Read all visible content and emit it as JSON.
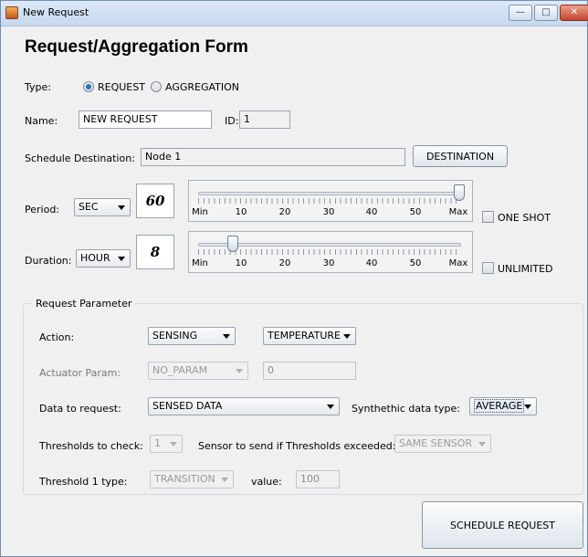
{
  "window": {
    "title": "New Request",
    "controls": {
      "minimize": "—",
      "maximize": "□",
      "close": "✕"
    }
  },
  "form": {
    "title": "Request/Aggregation Form",
    "type": {
      "label": "Type:",
      "options": [
        "REQUEST",
        "AGGREGATION"
      ],
      "selected": "REQUEST"
    },
    "name": {
      "label": "Name:",
      "value": "NEW REQUEST"
    },
    "id": {
      "label": "ID:",
      "value": "1"
    },
    "schedule_destination": {
      "label": "Schedule Destination:",
      "value": "Node 1",
      "button": "DESTINATION"
    },
    "period": {
      "label": "Period:",
      "unit": "SEC",
      "value": "60",
      "slider": {
        "min_label": "Min",
        "max_label": "Max",
        "ticks": [
          "10",
          "20",
          "30",
          "40",
          "50"
        ],
        "level": 1.0
      },
      "checkbox": "ONE SHOT",
      "checked": false
    },
    "duration": {
      "label": "Duration:",
      "unit": "HOUR",
      "value": "8",
      "slider": {
        "min_label": "Min",
        "max_label": "Max",
        "ticks": [
          "10",
          "20",
          "30",
          "40",
          "50"
        ],
        "level": 0.13
      },
      "checkbox": "UNLIMITED",
      "checked": false
    }
  },
  "request_parameter": {
    "title": "Request Parameter",
    "action": {
      "label": "Action:",
      "value": "SENSING",
      "value2": "TEMPERATURE"
    },
    "actuator_param": {
      "label": "Actuator Param:",
      "value": "NO_PARAM",
      "field": "0"
    },
    "data_to_request": {
      "label": "Data to request:",
      "value": "SENSED DATA",
      "synthetic_label": "Synthethic data type:",
      "synthetic_value": "AVERAGE"
    },
    "thresholds": {
      "label": "Thresholds to check:",
      "value": "1",
      "sensor_label": "Sensor to send if Thresholds exceeded:",
      "sensor_value": "SAME SENSOR"
    },
    "threshold1": {
      "label": "Threshold 1 type:",
      "value": "TRANSITION",
      "value_label": "value:",
      "field": "100"
    }
  },
  "actions": {
    "schedule": "SCHEDULE REQUEST"
  },
  "colors": {
    "accent": "#2d6fb5",
    "window_border": "#6f8db1",
    "background": "#f0f0f0"
  }
}
